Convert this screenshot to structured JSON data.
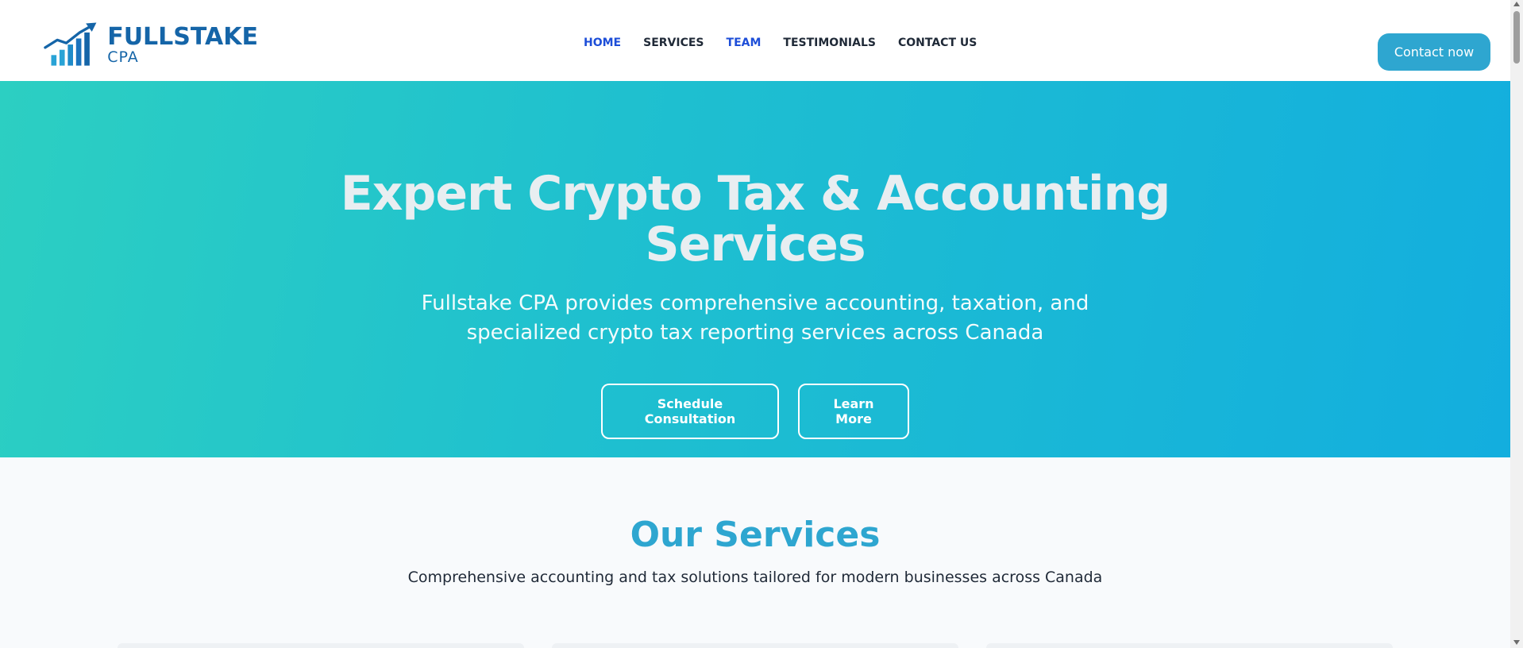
{
  "brand": {
    "name": "FULLSTAKE",
    "sub": "CPA",
    "logo_icon": "bar-chart-trend-up-icon",
    "color": "#1565a8"
  },
  "nav": {
    "items": [
      {
        "label": "HOME",
        "active": true
      },
      {
        "label": "SERVICES",
        "active": false
      },
      {
        "label": "TEAM",
        "active": true
      },
      {
        "label": "TESTIMONIALS",
        "active": false
      },
      {
        "label": "CONTACT US",
        "active": false
      }
    ],
    "active_color": "#1d4ed8"
  },
  "header": {
    "contact_label": "Contact now",
    "contact_color": "#2ea6d0"
  },
  "hero": {
    "title_line1": "Expert Crypto Tax & Accounting",
    "title_line2": "Services",
    "subtitle_line1": "Fullstake CPA provides comprehensive accounting, taxation, and",
    "subtitle_line2": "specialized crypto tax reporting services across Canada",
    "primary_button": "Schedule Consultation",
    "secondary_button": "Learn More",
    "gradient_start": "#2ccfc2",
    "gradient_end": "#13aede"
  },
  "services": {
    "title": "Our Services",
    "subtitle": "Comprehensive accounting and tax solutions tailored for modern businesses across Canada",
    "title_color": "#2ea6d0"
  }
}
